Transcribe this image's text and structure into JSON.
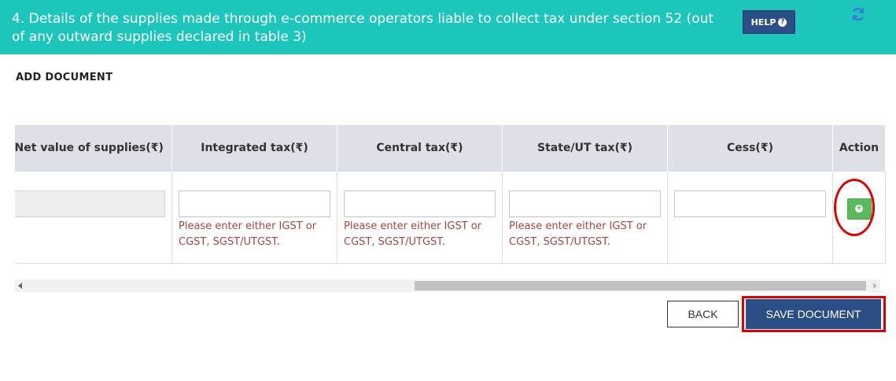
{
  "banner": {
    "title": "4. Details of the supplies made through e-commerce operators liable to collect tax under section 52 (out of any outward supplies declared in table 3)",
    "help_label": "HELP",
    "help_icon": "question-circle-icon",
    "refresh_icon": "refresh-icon"
  },
  "section": {
    "label": "ADD DOCUMENT"
  },
  "table": {
    "headers": [
      "Net value of supplies(₹)",
      "Integrated tax(₹)",
      "Central tax(₹)",
      "State/UT tax(₹)",
      "Cess(₹)",
      "Action"
    ],
    "errors": {
      "igst": "Please enter either IGST or CGST, SGST/UTGST.",
      "cgst": "Please enter either IGST or CGST, SGST/UTGST.",
      "sgst": "Please enter either IGST or CGST, SGST/UTGST."
    },
    "add_icon": "plus-circle-icon"
  },
  "buttons": {
    "back": "BACK",
    "save": "SAVE DOCUMENT"
  },
  "colors": {
    "banner": "#1cc6bb",
    "primary": "#2c4e86",
    "add": "#5cb85c",
    "error": "#a94442",
    "highlight": "#e00000"
  }
}
